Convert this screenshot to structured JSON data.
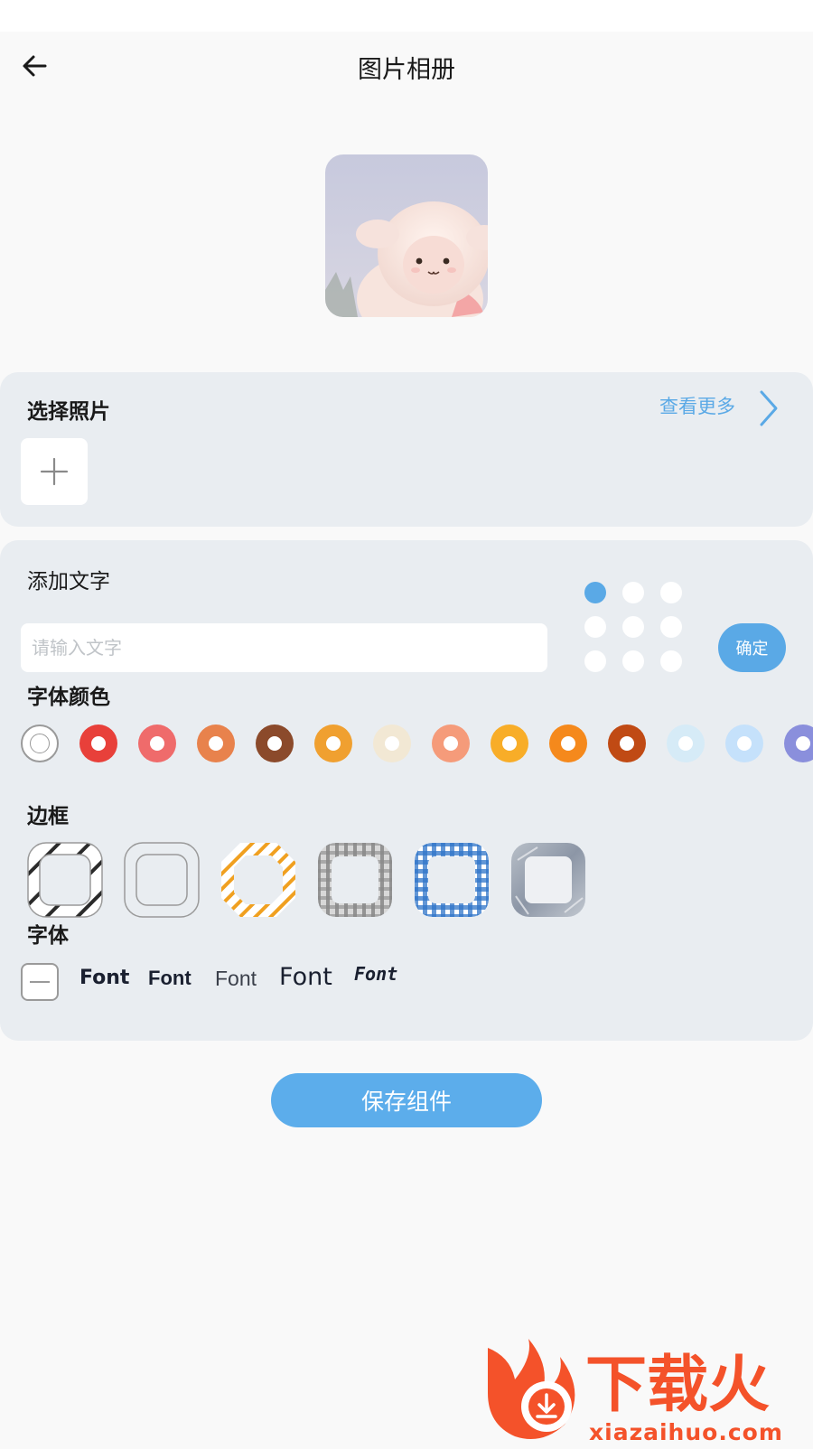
{
  "header": {
    "title": "图片相册",
    "back_icon": "arrow-left-icon"
  },
  "preview": {
    "alt": "lamb plush photo"
  },
  "photos": {
    "title": "选择照片",
    "more_label": "查看更多",
    "more_icon": "chevron-right-icon",
    "add_icon": "plus-icon"
  },
  "text": {
    "title": "添加文字",
    "placeholder": "请输入文字",
    "value": "",
    "confirm_label": "确定",
    "selected_position": 0
  },
  "font_color": {
    "title": "字体颜色",
    "colors": [
      "none",
      "#e8403a",
      "#ef6b6b",
      "#e8824c",
      "#8b4a2b",
      "#f0a030",
      "#f2e8d4",
      "#f59b7a",
      "#f8ad28",
      "#f5891c",
      "#c04a14",
      "#d6ebf7",
      "#c5e1fb",
      "#8a8fdc"
    ]
  },
  "border": {
    "title": "边框",
    "options": [
      "diagonal-stripes",
      "plain",
      "orange-stripes",
      "gray-plaid",
      "blue-gingham",
      "photo-texture"
    ]
  },
  "font": {
    "title": "字体",
    "options": [
      "Font",
      "Font",
      "Font",
      "Font",
      "Font"
    ]
  },
  "save_label": "保存组件",
  "watermark": {
    "brand": "下载火",
    "url": "xiazaihuo.com"
  }
}
